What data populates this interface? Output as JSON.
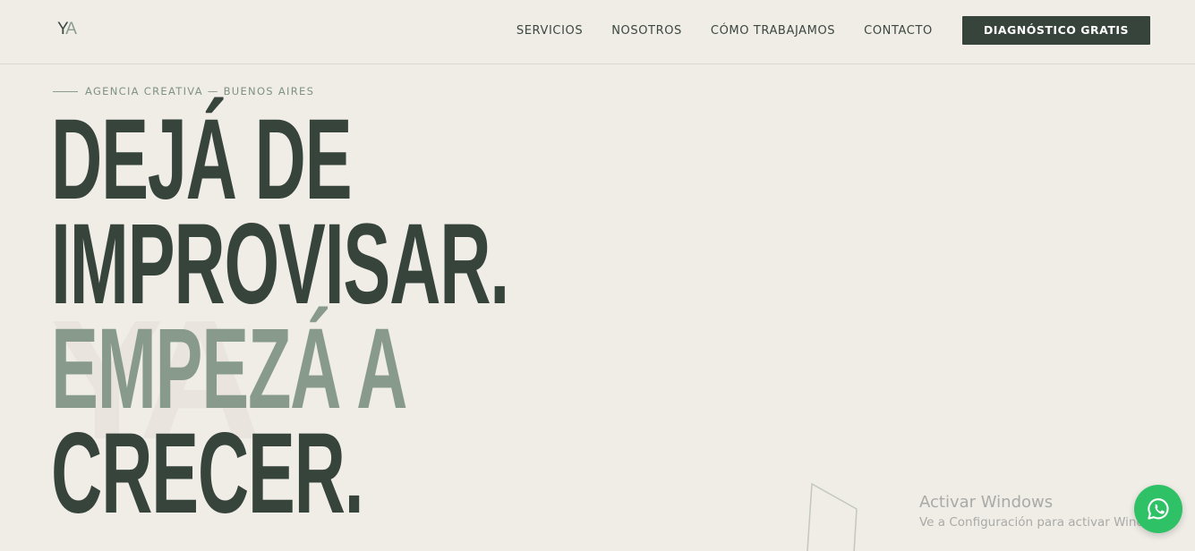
{
  "header": {
    "logo": {
      "y": "Y",
      "a": "A"
    },
    "nav": [
      {
        "label": "SERVICIOS"
      },
      {
        "label": "NOSOTROS"
      },
      {
        "label": "CÓMO TRABAJAMOS"
      },
      {
        "label": "CONTACTO"
      }
    ],
    "cta_label": "DIAGNÓSTICO GRATIS"
  },
  "hero": {
    "eyebrow": "AGENCIA CREATIVA — BUENOS AIRES",
    "line1": "DEJÁ DE",
    "line2": "IMPROVISAR.",
    "line3": "EMPEZÁ A",
    "line4": "CRECER.",
    "watermark": "YA"
  },
  "os_watermark": {
    "title": "Activar Windows",
    "subtitle": "Ve a Configuración para activar Windows."
  },
  "icons": {
    "whatsapp": "whatsapp-icon"
  },
  "colors": {
    "dark": "#37443c",
    "sage": "#889a8b",
    "background": "#f0ede7",
    "whatsapp": "#2ec165"
  }
}
